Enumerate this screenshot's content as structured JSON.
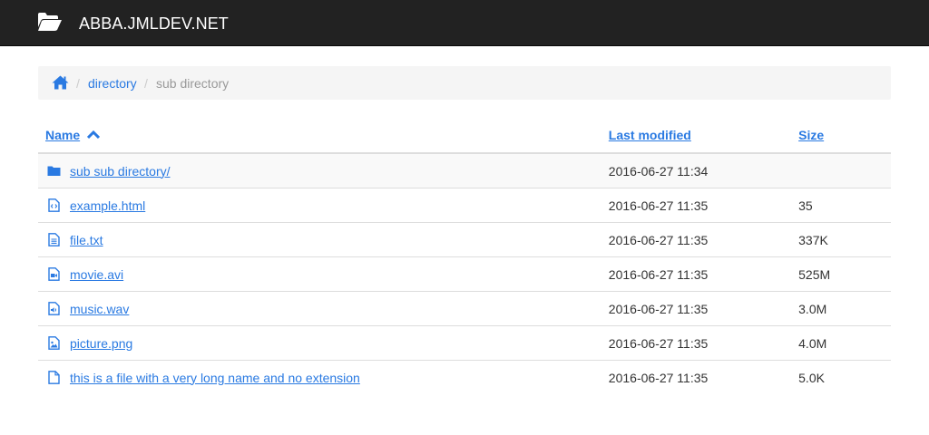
{
  "brand": {
    "title": "ABBA.JMLDEV.NET",
    "icon": "folder-open-icon"
  },
  "breadcrumb": {
    "home_icon": "home-icon",
    "separator": "/",
    "items": [
      {
        "label": "directory",
        "link": true
      },
      {
        "label": "sub directory",
        "link": false
      }
    ]
  },
  "table": {
    "headers": {
      "name": "Name",
      "last_modified": "Last modified",
      "size": "Size"
    },
    "sort_icon": "chevron-up-icon",
    "rows": [
      {
        "icon": "folder-icon",
        "name": "sub sub directory/",
        "modified": "2016-06-27 11:34",
        "size": ""
      },
      {
        "icon": "file-code-icon",
        "name": "example.html",
        "modified": "2016-06-27 11:35",
        "size": "35"
      },
      {
        "icon": "file-text-icon",
        "name": "file.txt",
        "modified": "2016-06-27 11:35",
        "size": "337K"
      },
      {
        "icon": "file-video-icon",
        "name": "movie.avi",
        "modified": "2016-06-27 11:35",
        "size": "525M"
      },
      {
        "icon": "file-audio-icon",
        "name": "music.wav",
        "modified": "2016-06-27 11:35",
        "size": "3.0M"
      },
      {
        "icon": "file-image-icon",
        "name": "picture.png",
        "modified": "2016-06-27 11:35",
        "size": "4.0M"
      },
      {
        "icon": "file-icon",
        "name": "this is a file with a very long name and no extension",
        "modified": "2016-06-27 11:35",
        "size": "5.0K"
      }
    ]
  },
  "colors": {
    "navbar": "#222222",
    "link": "#2a7ae2",
    "breadcrumb_bg": "#f5f5f5",
    "muted": "#999999"
  }
}
